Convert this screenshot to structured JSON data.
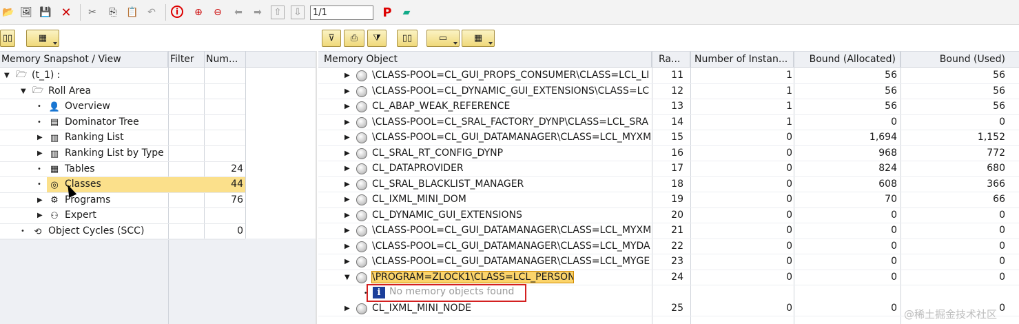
{
  "toolbar": {
    "page": "1/1",
    "icons": [
      "open-icon",
      "screen-icon",
      "save-icon",
      "delete-icon",
      "cut-icon",
      "copy-icon",
      "paste-icon",
      "undo-icon",
      "info-icon",
      "zoom-in-icon",
      "zoom-out-icon",
      "arrow-left-icon",
      "arrow-right-icon",
      "arrow-up-icon",
      "arrow-down-icon",
      "print-p-icon",
      "chart-icon"
    ]
  },
  "left": {
    "headers": {
      "view": "Memory Snapshot / View",
      "filter": "Filter",
      "num": "Num..."
    },
    "rows": [
      {
        "label": "(t_1) :",
        "icon": "folder-open-icon",
        "twisty": "▼",
        "count": ""
      },
      {
        "label": "Roll Area",
        "icon": "folder-open-icon",
        "twisty": "▼",
        "count": ""
      },
      {
        "label": "Overview",
        "icon": "person-icon",
        "twisty": "•",
        "count": ""
      },
      {
        "label": "Dominator Tree",
        "icon": "tree-icon",
        "twisty": "•",
        "count": ""
      },
      {
        "label": "Ranking List",
        "icon": "list-icon",
        "twisty": "▶",
        "count": ""
      },
      {
        "label": "Ranking List by Type",
        "icon": "list-icon",
        "twisty": "▶",
        "count": ""
      },
      {
        "label": "Tables",
        "icon": "table-icon",
        "twisty": "•",
        "count": "24"
      },
      {
        "label": "Classes",
        "icon": "object-icon",
        "twisty": "•",
        "count": "44"
      },
      {
        "label": "Programs",
        "icon": "gear-icon",
        "twisty": "▶",
        "count": "76"
      },
      {
        "label": "Expert",
        "icon": "expert-icon",
        "twisty": "▶",
        "count": ""
      },
      {
        "label": "Object Cycles (SCC)",
        "icon": "cycle-icon",
        "twisty": "•",
        "count": "0"
      }
    ]
  },
  "right": {
    "headers": {
      "obj": "Memory Object",
      "rank": "Ra...",
      "inst": "Number of Instan...",
      "alloc": "Bound (Allocated)",
      "used": "Bound (Used)"
    },
    "rows": [
      {
        "name": "\\CLASS-POOL=CL_GUI_PROPS_CONSUMER\\CLASS=LCL_LI",
        "rank": "11",
        "inst": "1",
        "alloc": "56",
        "used": "56"
      },
      {
        "name": "\\CLASS-POOL=CL_DYNAMIC_GUI_EXTENSIONS\\CLASS=LC",
        "rank": "12",
        "inst": "1",
        "alloc": "56",
        "used": "56"
      },
      {
        "name": "CL_ABAP_WEAK_REFERENCE",
        "rank": "13",
        "inst": "1",
        "alloc": "56",
        "used": "56"
      },
      {
        "name": "\\CLASS-POOL=CL_SRAL_FACTORY_DYNP\\CLASS=LCL_SRA",
        "rank": "14",
        "inst": "1",
        "alloc": "0",
        "used": "0"
      },
      {
        "name": "\\CLASS-POOL=CL_GUI_DATAMANAGER\\CLASS=LCL_MYXM",
        "rank": "15",
        "inst": "0",
        "alloc": "1,694",
        "used": "1,152"
      },
      {
        "name": "CL_SRAL_RT_CONFIG_DYNP",
        "rank": "16",
        "inst": "0",
        "alloc": "968",
        "used": "772"
      },
      {
        "name": "CL_DATAPROVIDER",
        "rank": "17",
        "inst": "0",
        "alloc": "824",
        "used": "680"
      },
      {
        "name": "CL_SRAL_BLACKLIST_MANAGER",
        "rank": "18",
        "inst": "0",
        "alloc": "608",
        "used": "366"
      },
      {
        "name": "CL_IXML_MINI_DOM",
        "rank": "19",
        "inst": "0",
        "alloc": "70",
        "used": "66"
      },
      {
        "name": "CL_DYNAMIC_GUI_EXTENSIONS",
        "rank": "20",
        "inst": "0",
        "alloc": "0",
        "used": "0"
      },
      {
        "name": "\\CLASS-POOL=CL_GUI_DATAMANAGER\\CLASS=LCL_MYXM",
        "rank": "21",
        "inst": "0",
        "alloc": "0",
        "used": "0"
      },
      {
        "name": "\\CLASS-POOL=CL_GUI_DATAMANAGER\\CLASS=LCL_MYDA",
        "rank": "22",
        "inst": "0",
        "alloc": "0",
        "used": "0"
      },
      {
        "name": "\\CLASS-POOL=CL_GUI_DATAMANAGER\\CLASS=LCL_MYGE",
        "rank": "23",
        "inst": "0",
        "alloc": "0",
        "used": "0"
      },
      {
        "name": "\\PROGRAM=ZLOCK1\\CLASS=LCL_PERSON",
        "rank": "24",
        "inst": "0",
        "alloc": "0",
        "used": "0"
      },
      {
        "name": "CL_IXML_MINI_NODE",
        "rank": "25",
        "inst": "0",
        "alloc": "0",
        "used": "0"
      }
    ],
    "no_memory": "No memory objects found"
  },
  "watermark": "@稀土掘金技术社区"
}
